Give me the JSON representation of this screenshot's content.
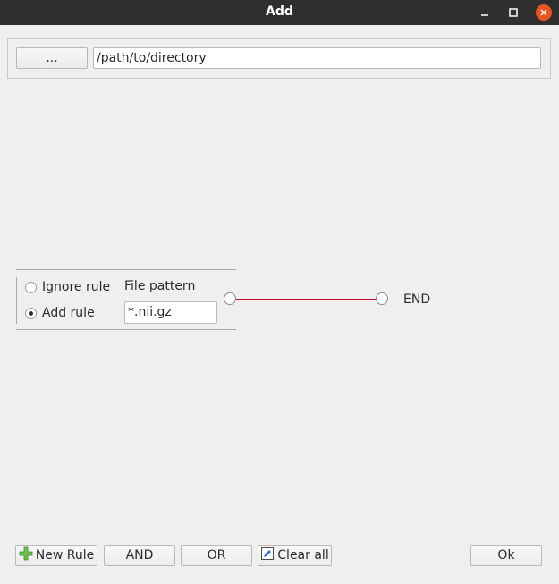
{
  "window": {
    "title": "Add",
    "minimize_icon": "minimize-icon",
    "maximize_icon": "maximize-icon",
    "close_icon": "close-icon",
    "close_color": "#e95420"
  },
  "path_bar": {
    "browse_label": "...",
    "path_value": "/path/to/directory"
  },
  "rule": {
    "ignore_label": "Ignore rule",
    "add_label": "Add rule",
    "selected": "Add rule",
    "pattern_label": "File pattern",
    "pattern_value": "*.nii.gz",
    "end_label": "END",
    "edge_color": "#c8102e"
  },
  "footer": {
    "new_rule_label": "New Rule",
    "new_rule_icon": "plus-icon",
    "and_label": "AND",
    "or_label": "OR",
    "clear_label": "Clear all",
    "clear_icon": "edit-icon",
    "ok_label": "Ok"
  }
}
